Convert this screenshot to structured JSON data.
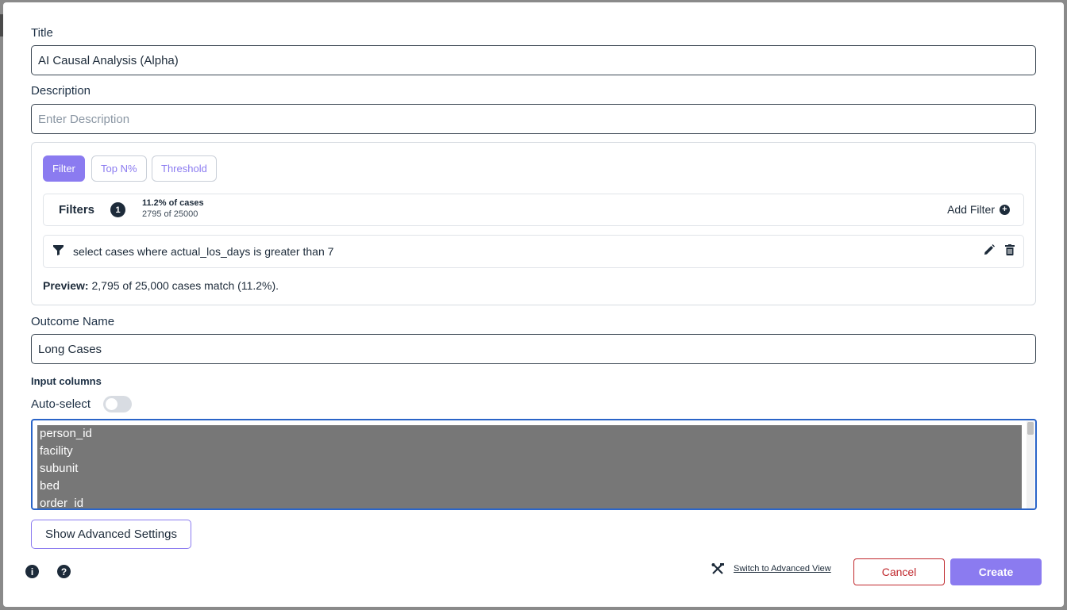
{
  "form": {
    "title_label": "Title",
    "title_value": "AI Causal Analysis (Alpha)",
    "description_label": "Description",
    "description_placeholder": "Enter Description"
  },
  "segments": {
    "filter": "Filter",
    "top_n": "Top N%",
    "threshold": "Threshold"
  },
  "filters": {
    "title": "Filters",
    "count": "1",
    "percent_text": "11.2% of cases",
    "count_text": "2795 of 25000",
    "add_label": "Add Filter",
    "rows": [
      {
        "text": "select cases where actual_los_days is greater than 7"
      }
    ],
    "preview_label": "Preview:",
    "preview_text": "2,795 of 25,000 cases match (11.2%)."
  },
  "outcome": {
    "label": "Outcome Name",
    "value": "Long Cases"
  },
  "input_columns": {
    "heading": "Input columns",
    "auto_select_label": "Auto-select",
    "auto_select_on": false,
    "options": [
      "person_id",
      "facility",
      "subunit",
      "bed",
      "order_id"
    ]
  },
  "actions": {
    "advanced_settings": "Show Advanced Settings",
    "switch_view": "Switch to Advanced View",
    "cancel": "Cancel",
    "create": "Create"
  },
  "icons": {
    "info": "info-icon",
    "help": "help-icon",
    "tools": "tools-icon"
  },
  "colors": {
    "accent": "#8b7bf0",
    "danger": "#c0282d",
    "dark": "#1d2b3a",
    "focus": "#2a64c8"
  }
}
